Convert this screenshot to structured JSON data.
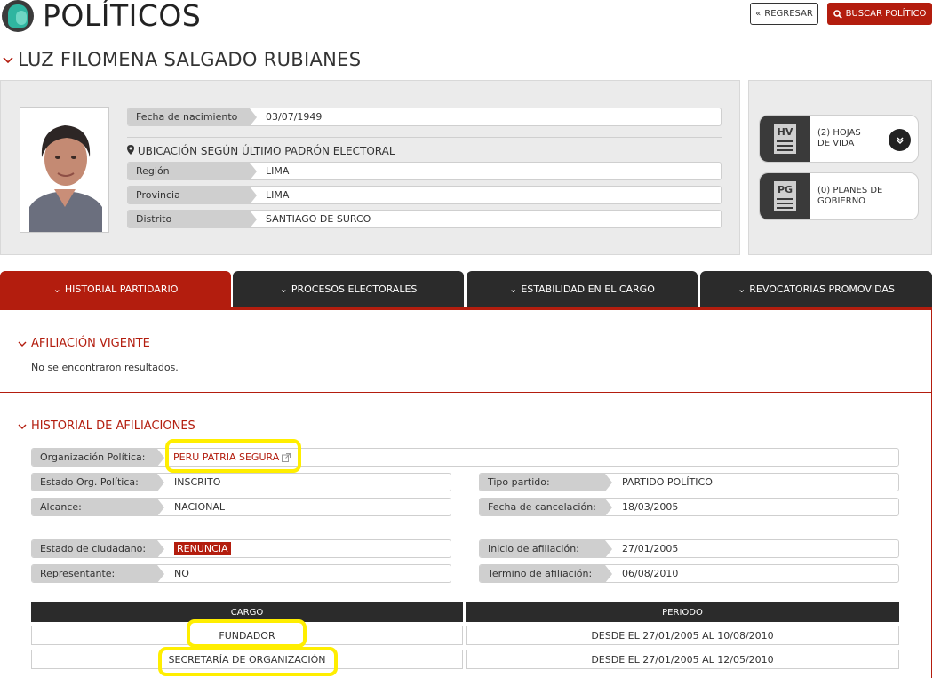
{
  "header": {
    "title": "POLÍTICOS",
    "back_label": "REGRESAR",
    "search_label": "BUSCAR POLÍTICO"
  },
  "person": {
    "name": "LUZ FILOMENA SALGADO RUBIANES",
    "birth_label": "Fecha de nacimiento",
    "birth_value": "03/07/1949",
    "location_title": "UBICACIÓN SEGÚN ÚLTIMO PADRÓN ELECTORAL",
    "region_label": "Región",
    "region_value": "LIMA",
    "province_label": "Provincia",
    "province_value": "LIMA",
    "district_label": "Distrito",
    "district_value": "SANTIAGO DE SURCO"
  },
  "documents": [
    {
      "code": "HV",
      "label_line1": "(2) HOJAS",
      "label_line2": "DE VIDA"
    },
    {
      "code": "PG",
      "label_line1": "(0) PLANES DE",
      "label_line2": "GOBIERNO"
    }
  ],
  "tabs": [
    {
      "label": "HISTORIAL PARTIDARIO",
      "active": true
    },
    {
      "label": "PROCESOS ELECTORALES",
      "active": false
    },
    {
      "label": "ESTABILIDAD EN EL CARGO",
      "active": false
    },
    {
      "label": "REVOCATORIAS PROMOVIDAS",
      "active": false
    }
  ],
  "afiliacion_vigente": {
    "title": "AFILIACIÓN VIGENTE",
    "message": "No se encontraron resultados."
  },
  "historial": {
    "title": "HISTORIAL DE AFILIACIONES",
    "org_label": "Organización Política:",
    "org_value": "PERU PATRIA SEGURA",
    "estado_org_label": "Estado Org. Política:",
    "estado_org_value": "INSCRITO",
    "tipo_partido_label": "Tipo partido:",
    "tipo_partido_value": "PARTIDO POLÍTICO",
    "alcance_label": "Alcance:",
    "alcance_value": "NACIONAL",
    "fecha_cancel_label": "Fecha de cancelación:",
    "fecha_cancel_value": "18/03/2005",
    "estado_ciud_label": "Estado de ciudadano:",
    "estado_ciud_value": "RENUNCIA",
    "inicio_label": "Inicio de afiliación:",
    "inicio_value": "27/01/2005",
    "representante_label": "Representante:",
    "representante_value": "NO",
    "termino_label": "Termino de afiliación:",
    "termino_value": "06/08/2010"
  },
  "cargo_table": {
    "headers": [
      "CARGO",
      "PERIODO"
    ],
    "rows": [
      {
        "cargo": "FUNDADOR",
        "periodo": "DESDE EL 27/01/2005 AL 10/08/2010"
      },
      {
        "cargo": "SECRETARÍA DE ORGANIZACIÓN",
        "periodo": "DESDE EL 27/01/2005 AL 12/05/2010"
      }
    ]
  },
  "colors": {
    "accent": "#b31d0e",
    "dark": "#2b2b2b",
    "panel": "#ebebeb",
    "highlight": "#ffee00"
  }
}
